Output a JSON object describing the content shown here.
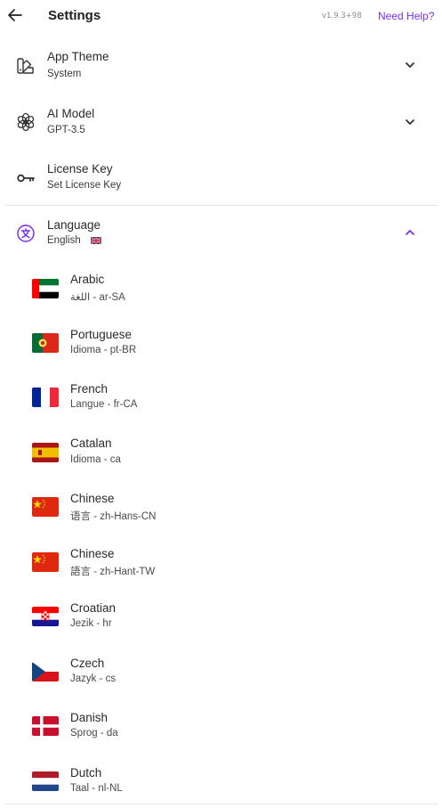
{
  "header": {
    "title": "Settings",
    "version": "v1.9.3+98",
    "help_label": "Need Help?"
  },
  "colors": {
    "accent": "#7b2ff2",
    "text": "#1f1f1f",
    "divider": "#e3e3e3"
  },
  "settings": {
    "app_theme": {
      "label": "App Theme",
      "value": "System",
      "icon": "palette-icon",
      "expanded": false
    },
    "ai_model": {
      "label": "AI Model",
      "value": "GPT-3.5",
      "icon": "openai-icon",
      "expanded": false
    },
    "license_key": {
      "label": "License Key",
      "value": "Set License Key",
      "icon": "key-icon"
    },
    "language": {
      "label": "Language",
      "value": "English",
      "icon": "translate-icon",
      "flag": "uk-flag",
      "expanded": true
    }
  },
  "languages": [
    {
      "name": "Arabic",
      "sub": "اللغة - ar-SA",
      "flag": "uae-flag"
    },
    {
      "name": "Portuguese",
      "sub": "Idioma - pt-BR",
      "flag": "portugal-flag"
    },
    {
      "name": "French",
      "sub": "Langue - fr-CA",
      "flag": "france-flag"
    },
    {
      "name": "Catalan",
      "sub": "Idioma - ca",
      "flag": "spain-flag"
    },
    {
      "name": "Chinese",
      "sub": "语言 - zh-Hans-CN",
      "flag": "china-flag"
    },
    {
      "name": "Chinese",
      "sub": "語言 - zh-Hant-TW",
      "flag": "china-flag"
    },
    {
      "name": "Croatian",
      "sub": "Jezik - hr",
      "flag": "croatia-flag"
    },
    {
      "name": "Czech",
      "sub": "Jazyk - cs",
      "flag": "czech-flag"
    },
    {
      "name": "Danish",
      "sub": "Sprog - da",
      "flag": "denmark-flag"
    },
    {
      "name": "Dutch",
      "sub": "Taal - nl-NL",
      "flag": "netherlands-flag"
    }
  ]
}
